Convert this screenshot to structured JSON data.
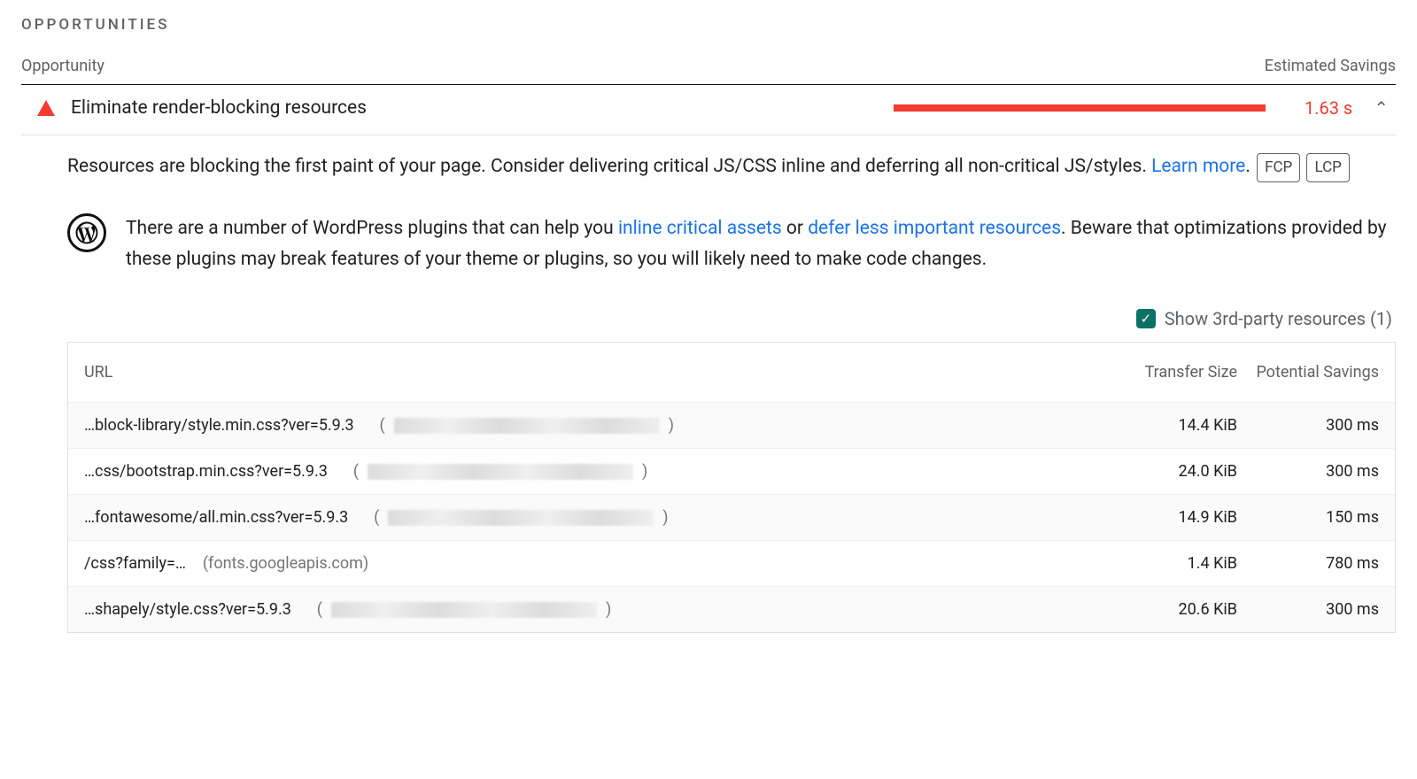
{
  "section": {
    "title": "OPPORTUNITIES"
  },
  "columns": {
    "opportunity": "Opportunity",
    "savings": "Estimated Savings"
  },
  "audit": {
    "title": "Eliminate render-blocking resources",
    "savingsDisplay": "1.63 s",
    "barFillPercent": 100,
    "description": {
      "lead": "Resources are blocking the first paint of your page. Consider delivering critical JS/CSS inline and deferring all non-critical JS/styles. ",
      "learnMore": "Learn more",
      "period": "."
    },
    "metricPills": [
      "FCP",
      "LCP"
    ],
    "wordpressTip": {
      "part1": "There are a number of WordPress plugins that can help you ",
      "link1": "inline critical assets",
      "part2": " or ",
      "link2": "defer less important resources",
      "part3": ". Beware that optimizations provided by these plugins may break features of your theme or plugins, so you will likely need to make code changes."
    }
  },
  "thirdPartyToggle": {
    "label": "Show 3rd-party resources (1)",
    "checked": true
  },
  "table": {
    "headers": {
      "url": "URL",
      "transferSize": "Transfer Size",
      "potentialSavings": "Potential Savings"
    },
    "rows": [
      {
        "path": "…block-library/style.min.css?ver=5.9.3",
        "originRedacted": true,
        "originRedactedWidth": 300,
        "transferSize": "14.4 KiB",
        "potentialSavings": "300 ms"
      },
      {
        "path": "…css/bootstrap.min.css?ver=5.9.3",
        "originRedacted": true,
        "originRedactedWidth": 300,
        "transferSize": "24.0 KiB",
        "potentialSavings": "300 ms"
      },
      {
        "path": "…fontawesome/all.min.css?ver=5.9.3",
        "originRedacted": true,
        "originRedactedWidth": 300,
        "transferSize": "14.9 KiB",
        "potentialSavings": "150 ms"
      },
      {
        "path": "/css?family=…",
        "originRedacted": false,
        "origin": "(fonts.googleapis.com)",
        "transferSize": "1.4 KiB",
        "potentialSavings": "780 ms"
      },
      {
        "path": "…shapely/style.css?ver=5.9.3",
        "originRedacted": true,
        "originRedactedWidth": 300,
        "transferSize": "20.6 KiB",
        "potentialSavings": "300 ms"
      }
    ]
  }
}
